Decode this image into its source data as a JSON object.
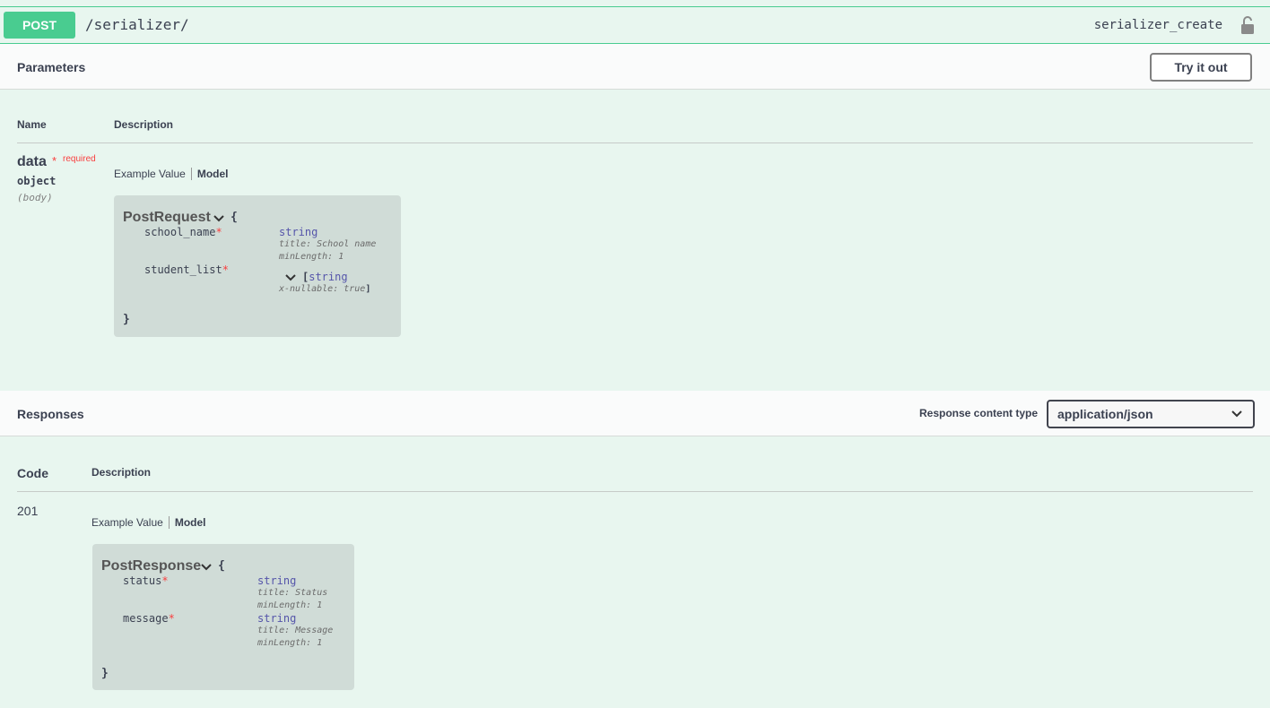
{
  "operation": {
    "method": "POST",
    "path": "/serializer/",
    "operation_id": "serializer_create",
    "lock_icon": "unlock-icon"
  },
  "parameters_section": {
    "title": "Parameters",
    "try_button": "Try it out",
    "col_name": "Name",
    "col_description": "Description",
    "param": {
      "name": "data",
      "required_star": "*",
      "required_text": "required",
      "type": "object",
      "in": "(body)"
    },
    "tab_example": "Example Value",
    "tab_model": "Model",
    "model": {
      "name": "PostRequest",
      "open_brace": "{",
      "close_brace": "}",
      "props": [
        {
          "name": "school_name",
          "star": "*",
          "type": "string",
          "meta1": "title: School name",
          "meta2": "minLength: 1"
        },
        {
          "name": "student_list",
          "star": "*",
          "type_prefix": "[",
          "type": "string",
          "meta1": "x-nullable: true",
          "type_suffix": "]"
        }
      ]
    }
  },
  "responses_section": {
    "title": "Responses",
    "content_type_label": "Response content type",
    "content_type_value": "application/json",
    "col_code": "Code",
    "col_description": "Description",
    "code": "201",
    "tab_example": "Example Value",
    "tab_model": "Model",
    "model": {
      "name": "PostResponse",
      "open_brace": "{",
      "close_brace": "}",
      "props": [
        {
          "name": "status",
          "star": "*",
          "type": "string",
          "meta1": "title: Status",
          "meta2": "minLength: 1"
        },
        {
          "name": "message",
          "star": "*",
          "type": "string",
          "meta1": "title: Message",
          "meta2": "minLength: 1"
        }
      ]
    }
  },
  "colors": {
    "post_green": "#49cc90",
    "background": "#e8f6ef",
    "required_red": "#f93e3e"
  }
}
